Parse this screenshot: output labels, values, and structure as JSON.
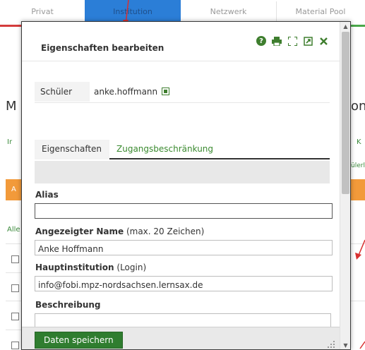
{
  "background": {
    "tabs": [
      "Privat",
      "Institution",
      "Netzwerk",
      "Material Pool"
    ],
    "fragment_left_heading": "M",
    "fragment_right_heading": "on",
    "fragment_ir": "Ir",
    "fragment_k": "K",
    "fragment_ler": "ülerl",
    "fragment_a": "A",
    "fragment_all": "Alle"
  },
  "modal": {
    "title": "Eigenschaften bearbeiten",
    "student_label": "Schüler",
    "student_value": "anke.hoffmann",
    "tabs": [
      {
        "label": "Eigenschaften",
        "active": true
      },
      {
        "label": "Zugangsbeschränkung",
        "active": false
      }
    ],
    "fields": {
      "alias_label": "Alias",
      "alias_value": "",
      "display_name_label": "Angezeigter Name",
      "display_name_hint": " (max. 20 Zeichen)",
      "display_name_value": "Anke Hoffmann",
      "main_institution_label": "Hauptinstitution",
      "main_institution_hint": " (Login)",
      "main_institution_value": "info@fobi.mpz-nordsachsen.lernsax.de",
      "description_label": "Beschreibung"
    },
    "save_label": "Daten speichern",
    "header_icons": [
      "help-icon",
      "print-icon",
      "fullscreen-icon",
      "popout-icon",
      "close-icon"
    ]
  },
  "colors": {
    "accent_green": "#3e7e2e",
    "button_green": "#2f7d2f",
    "tab_blue": "#2b7ed7",
    "tab_red": "#d43c3c",
    "tab_green": "#4aa84a",
    "orange": "#f29a3a",
    "annotation_red": "#d83030"
  }
}
